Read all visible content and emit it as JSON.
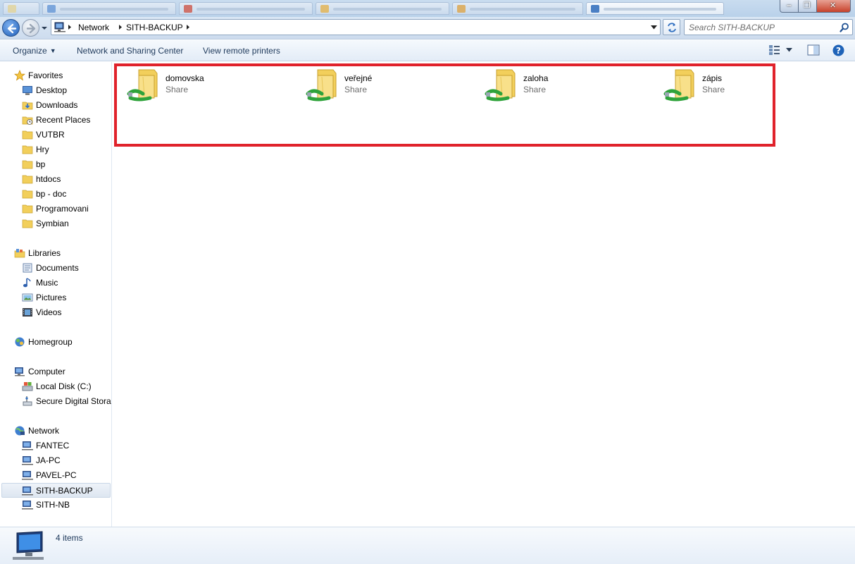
{
  "window": {
    "close_glyph": "✕",
    "max_glyph": "❐",
    "min_glyph": "–"
  },
  "address": {
    "crumbs": [
      "Network",
      "SITH-BACKUP"
    ]
  },
  "search": {
    "placeholder": "Search SITH-BACKUP"
  },
  "toolbar": {
    "organize_label": "Organize",
    "network_sharing_label": "Network and Sharing Center",
    "remote_printers_label": "View remote printers"
  },
  "sidebar": {
    "favorites": {
      "label": "Favorites",
      "items": [
        "Desktop",
        "Downloads",
        "Recent Places",
        "VUTBR",
        "Hry",
        "bp",
        "htdocs",
        "bp - doc",
        "Programovani",
        "Symbian"
      ]
    },
    "libraries": {
      "label": "Libraries",
      "items": [
        "Documents",
        "Music",
        "Pictures",
        "Videos"
      ]
    },
    "homegroup": {
      "label": "Homegroup"
    },
    "computer": {
      "label": "Computer",
      "items": [
        "Local Disk (C:)",
        "Secure Digital Storage Device (E:)"
      ]
    },
    "network": {
      "label": "Network",
      "items": [
        "FANTEC",
        "JA-PC",
        "PAVEL-PC",
        "SITH-BACKUP",
        "SITH-NB"
      ],
      "selected": "SITH-BACKUP"
    }
  },
  "shares": [
    {
      "name": "domovska",
      "type": "Share"
    },
    {
      "name": "veřejné",
      "type": "Share"
    },
    {
      "name": "zaloha",
      "type": "Share"
    },
    {
      "name": "zápis",
      "type": "Share"
    }
  ],
  "status": {
    "items_text": "4 items"
  },
  "colors": {
    "highlight_border": "#e0222b",
    "folder_yellow": "#f2cf5b",
    "share_green": "#2fa33b",
    "command_text": "#1e395b"
  }
}
